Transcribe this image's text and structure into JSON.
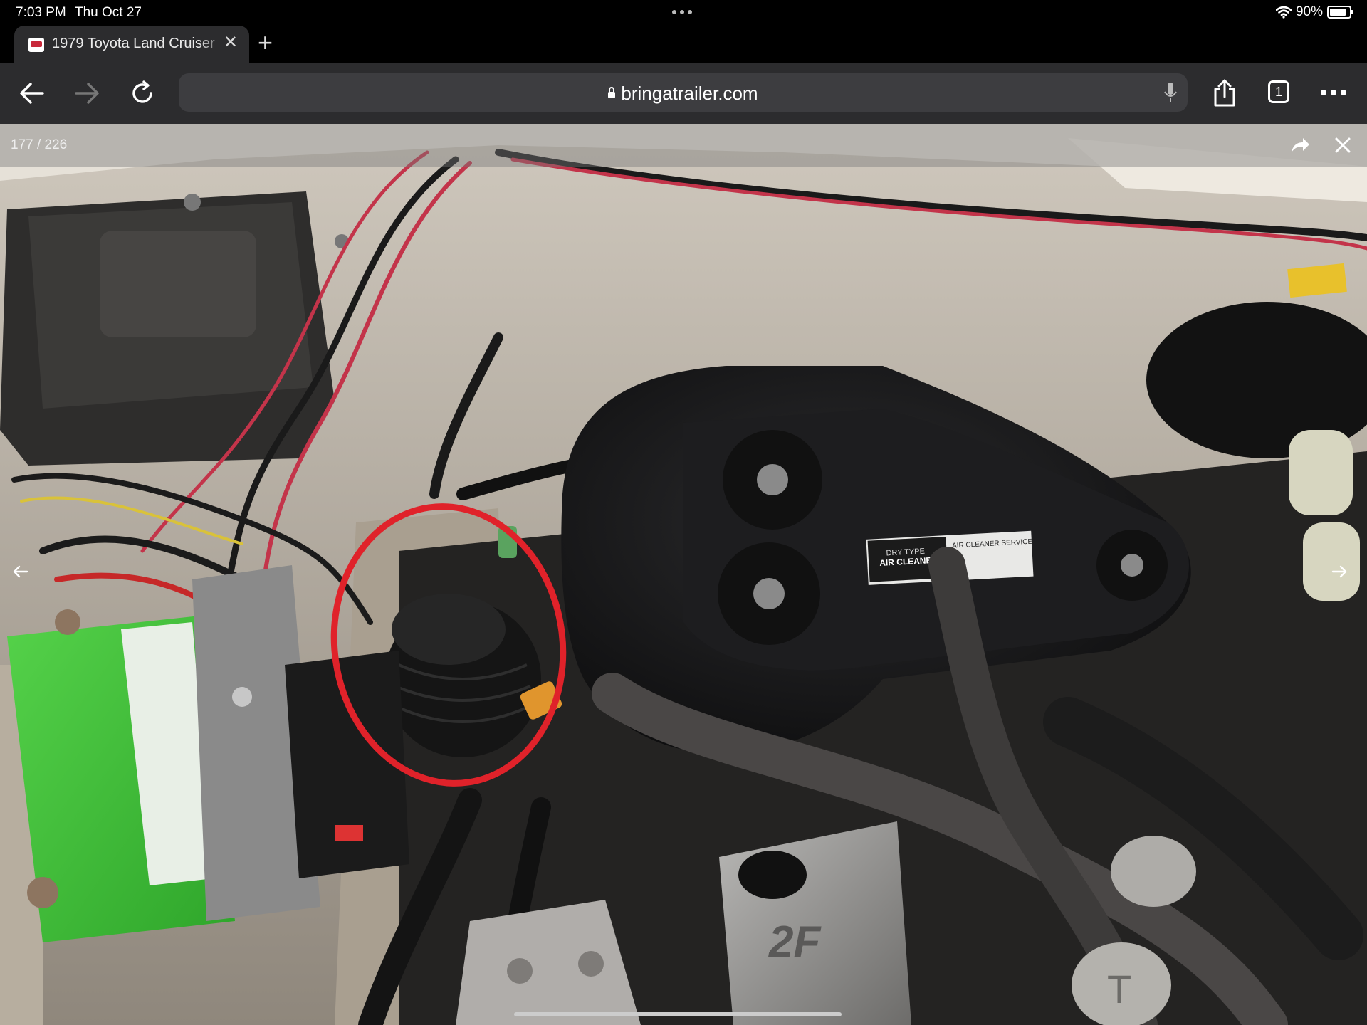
{
  "status_bar": {
    "time": "7:03 PM",
    "date": "Thu Oct 27",
    "battery_text": "90%",
    "battery_level": 0.9
  },
  "tab": {
    "title": "1979 Toyota Land Cruiser",
    "favicon": "bat-favicon-icon"
  },
  "toolbar": {
    "url": "bringatrailer.com",
    "tab_count": "1"
  },
  "viewer": {
    "counter": "177 / 226"
  },
  "photo": {
    "decal_line1": "DRY TYPE",
    "decal_line2": "AIR CLEANER",
    "decal_right": "AIR CLEANER SERVICE",
    "engine_cast": "2F",
    "annotation_color": "#e0222a"
  },
  "colors": {
    "accent_circle": "#e0222a",
    "battery_green": "#3fbf3a",
    "chrome_bg": "#2c2c2e"
  }
}
